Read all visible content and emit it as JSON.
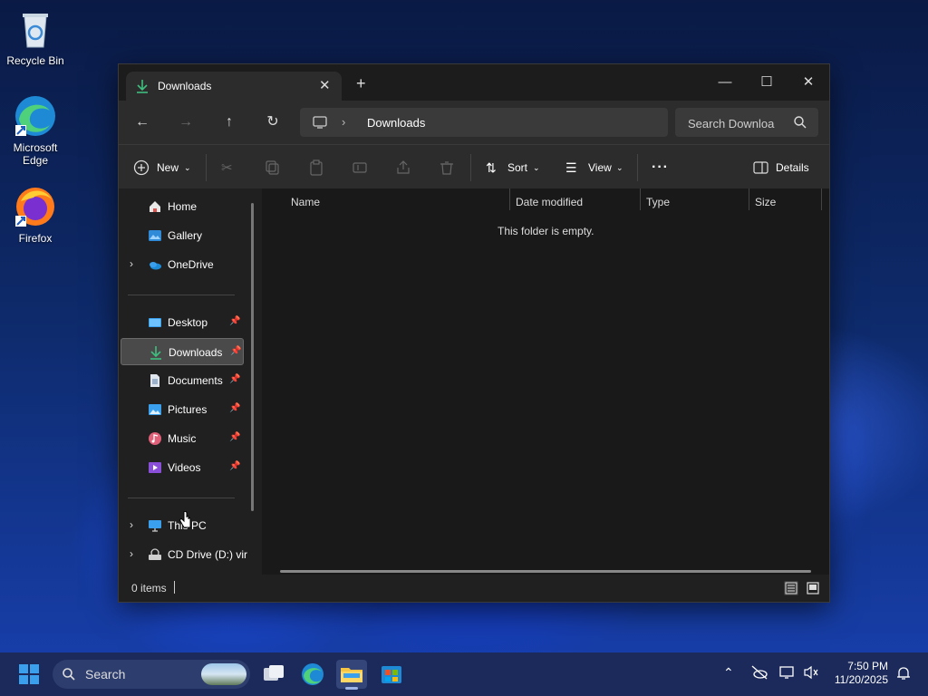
{
  "desktop": {
    "icons": [
      {
        "label": "Recycle Bin"
      },
      {
        "label": "Microsoft Edge"
      },
      {
        "label": "Firefox"
      }
    ]
  },
  "window": {
    "tab_title": "Downloads",
    "address": {
      "crumb": "Downloads"
    },
    "search": {
      "placeholder": "Search Downloa"
    },
    "toolbar": {
      "new_label": "New",
      "sort_label": "Sort",
      "view_label": "View",
      "details_label": "Details"
    },
    "sidebar": {
      "home": "Home",
      "gallery": "Gallery",
      "onedrive": "OneDrive",
      "desktop": "Desktop",
      "downloads": "Downloads",
      "documents": "Documents",
      "pictures": "Pictures",
      "music": "Music",
      "videos": "Videos",
      "this_pc": "This PC",
      "cd_drive": "CD Drive (D:) vir"
    },
    "columns": {
      "name": "Name",
      "date_modified": "Date modified",
      "type": "Type",
      "size": "Size"
    },
    "empty_message": "This folder is empty.",
    "status": {
      "items": "0 items"
    }
  },
  "taskbar": {
    "search_label": "Search",
    "time": "7:50 PM",
    "date": "11/20/2025"
  },
  "colors": {
    "accent_green": "#3fbf7f",
    "folder_yellow": "#f5c443",
    "edge_blue": "#1e8ad6"
  }
}
